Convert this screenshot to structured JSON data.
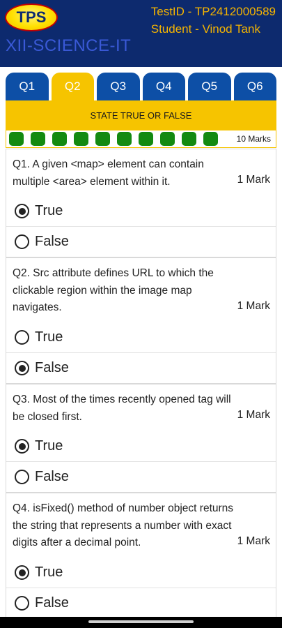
{
  "header": {
    "logo_text": "TPS",
    "app_title": "XII-SCIENCE-IT",
    "test_id": "TestID - TP2412000589",
    "student": "Student - Vinod Tank"
  },
  "tabs": [
    {
      "label": "Q1",
      "active": false
    },
    {
      "label": "Q2",
      "active": true
    },
    {
      "label": "Q3",
      "active": false
    },
    {
      "label": "Q4",
      "active": false
    },
    {
      "label": "Q5",
      "active": false
    },
    {
      "label": "Q6",
      "active": false
    }
  ],
  "section": {
    "title": "STATE TRUE OR FALSE",
    "progress_count": 10,
    "marks_label": "10 Marks"
  },
  "questions": [
    {
      "text": "Q1. A given <map> element can contain multiple <area> element within it.",
      "mark": "1 Mark",
      "options": [
        {
          "label": "True",
          "selected": true
        },
        {
          "label": "False",
          "selected": false
        }
      ]
    },
    {
      "text": "Q2. Src attribute defines URL to which the clickable region within the image map navigates.",
      "mark": "1 Mark",
      "options": [
        {
          "label": "True",
          "selected": false
        },
        {
          "label": "False",
          "selected": true
        }
      ]
    },
    {
      "text": "Q3. Most of the times recently opened tag will be closed first.",
      "mark": "1 Mark",
      "options": [
        {
          "label": "True",
          "selected": true
        },
        {
          "label": "False",
          "selected": false
        }
      ]
    },
    {
      "text": "Q4. isFixed() method of number object returns the string that represents a number with exact digits after a decimal point.",
      "mark": "1 Mark",
      "options": [
        {
          "label": "True",
          "selected": true
        },
        {
          "label": "False",
          "selected": false
        }
      ]
    }
  ],
  "colors": {
    "header_bg": "#0d2a6e",
    "accent_yellow": "#f6c400",
    "tab_blue": "#0d4fa6",
    "progress_green": "#138a10"
  }
}
